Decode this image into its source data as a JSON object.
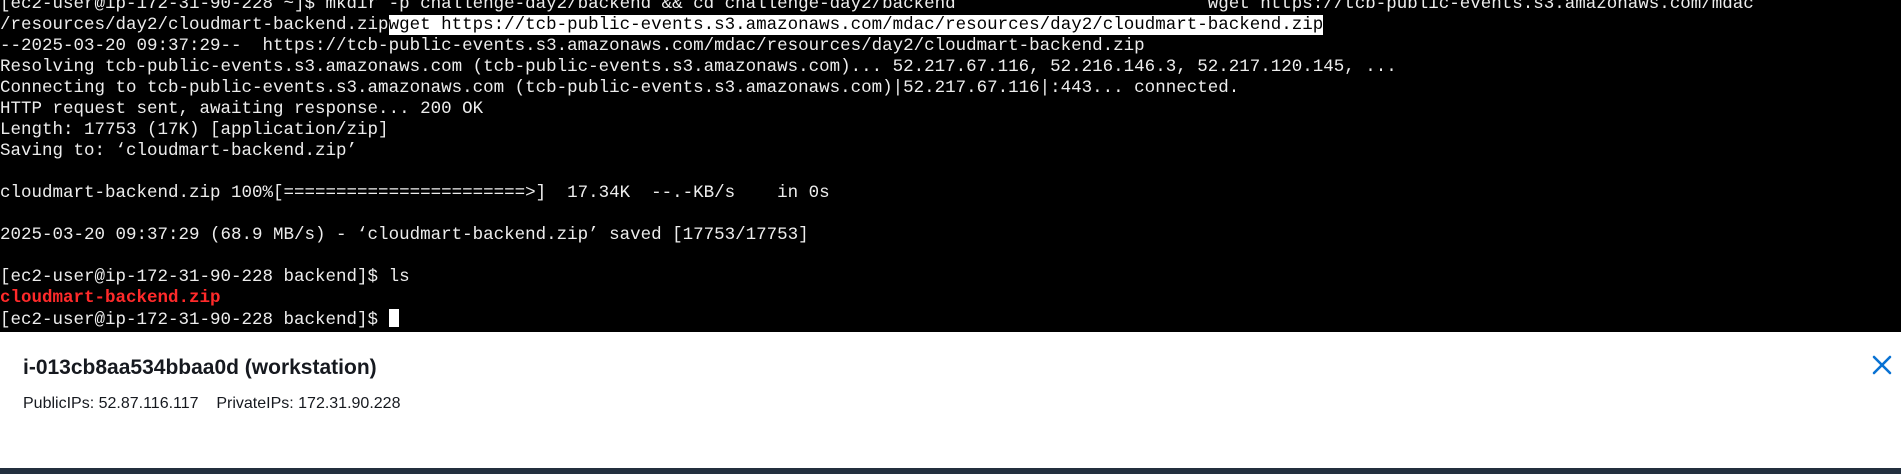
{
  "terminal": {
    "lines": [
      "[ec2-user@ip-172-31-90-228 ~]$ mkdir -p challenge-day2/backend && cd challenge-day2/backend                        wget https://tcb-public-events.s3.amazonaws.com/mdac",
      "/resources/day2/cloudmart-backend.zip",
      "--2025-03-20 09:37:29--  https://tcb-public-events.s3.amazonaws.com/mdac/resources/day2/cloudmart-backend.zip",
      "Resolving tcb-public-events.s3.amazonaws.com (tcb-public-events.s3.amazonaws.com)... 52.217.67.116, 52.216.146.3, 52.217.120.145, ...",
      "Connecting to tcb-public-events.s3.amazonaws.com (tcb-public-events.s3.amazonaws.com)|52.217.67.116|:443... connected.",
      "HTTP request sent, awaiting response... 200 OK",
      "Length: 17753 (17K) [application/zip]",
      "Saving to: ‘cloudmart-backend.zip’",
      "",
      "cloudmart-backend.zip 100%[=======================>]  17.34K  --.-KB/s    in 0s",
      "",
      "2025-03-20 09:37:29 (68.9 MB/s) - ‘cloudmart-backend.zip’ saved [17753/17753]",
      "",
      "[ec2-user@ip-172-31-90-228 backend]$ ls",
      "",
      "[ec2-user@ip-172-31-90-228 backend]$ "
    ],
    "highlighted_command": "wget https://tcb-public-events.s3.amazonaws.com/mdac/resources/day2/cloudmart-backend.zip",
    "ls_output": "cloudmart-backend.zip",
    "colors": {
      "background": "#000000",
      "text": "#ededed",
      "highlight_bg": "#ffffff",
      "archive_red": "#ff2a2a"
    }
  },
  "instance": {
    "title": "i-013cb8aa534bbaa0d (workstation)",
    "public_ips_label": "PublicIPs:",
    "public_ips_value": "52.87.116.117",
    "private_ips_label": "PrivateIPs:",
    "private_ips_value": "172.31.90.228",
    "close_icon": "close-icon",
    "accent_color": "#0972d3"
  }
}
